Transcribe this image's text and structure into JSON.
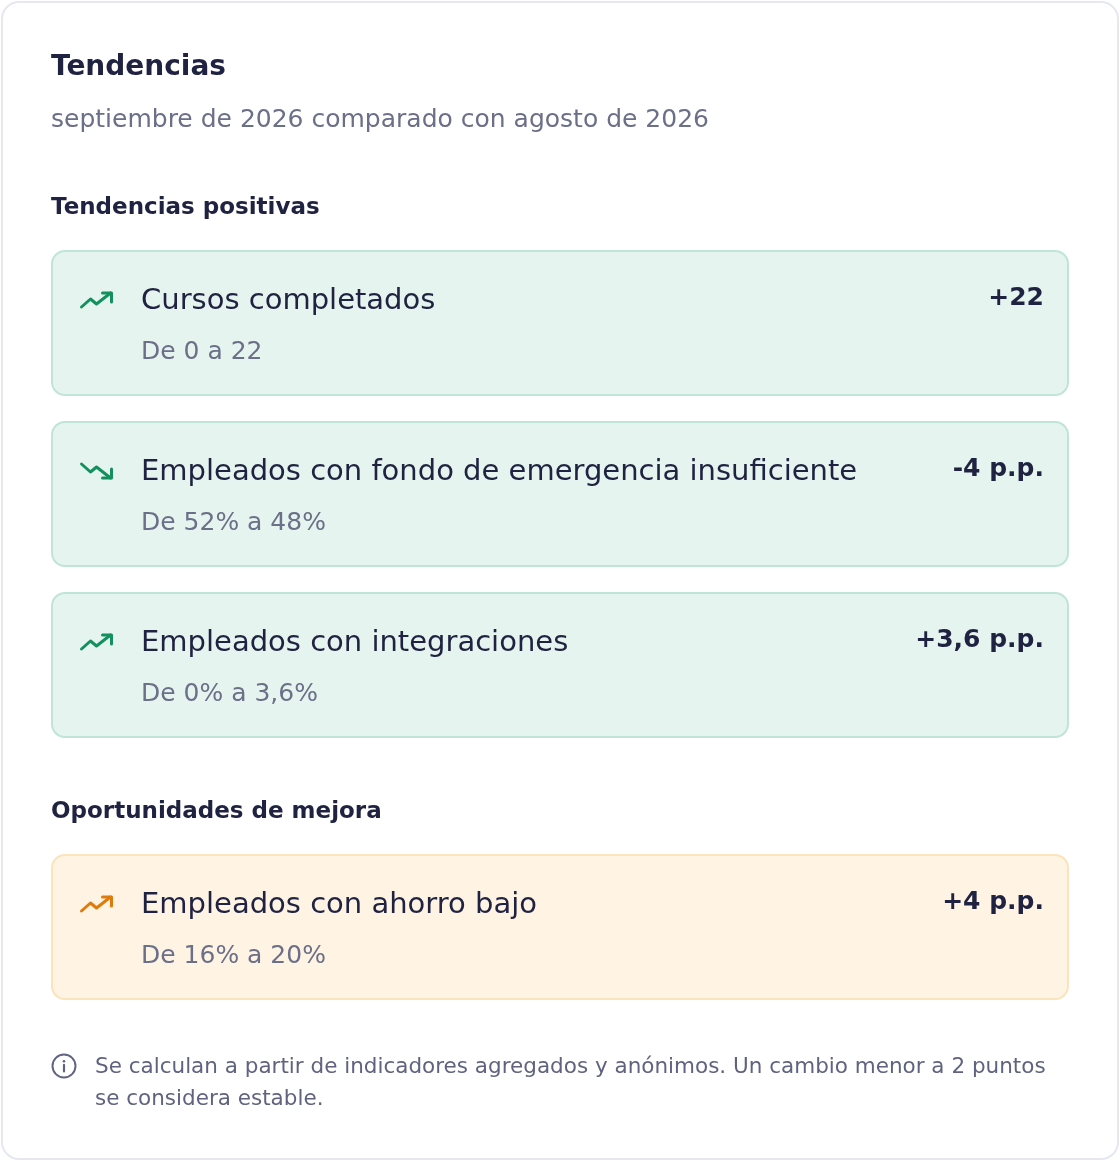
{
  "title": "Tendencias",
  "subtitle": "septiembre de 2026 comparado con agosto de 2026",
  "sections": [
    {
      "heading": "Tendencias positivas",
      "kind": "positive",
      "items": [
        {
          "title": "Cursos completados",
          "detail": "De 0 a 22",
          "change": "+22",
          "kind": "up"
        },
        {
          "title": "Empleados con fondo de emergencia insuficiente",
          "detail": "De 52% a 48%",
          "change": "-4 p.p.",
          "kind": "down"
        },
        {
          "title": "Empleados con integraciones",
          "detail": "De 0% a 3,6%",
          "change": "+3,6 p.p.",
          "kind": "up"
        }
      ]
    },
    {
      "heading": "Oportunidades de mejora",
      "kind": "improvement",
      "items": [
        {
          "title": "Empleados con ahorro bajo",
          "detail": "De 16% a 20%",
          "change": "+4 p.p.",
          "kind": "up"
        }
      ]
    }
  ],
  "note": "Se calculan a partir de indicadores agregados y anónimos. Un cambio menor a 2 puntos se considera estable."
}
